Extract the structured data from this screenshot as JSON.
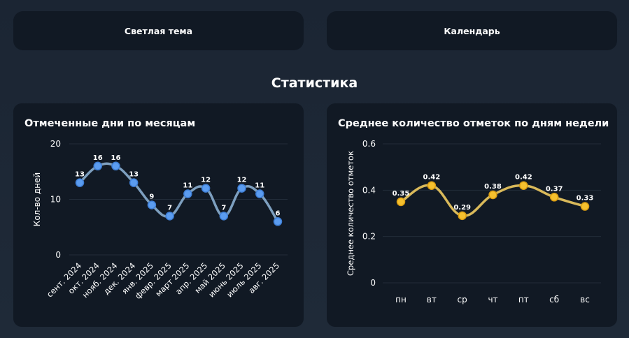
{
  "top_buttons": {
    "theme_label": "Светлая тема",
    "calendar_label": "Календарь"
  },
  "section_title": "Статистика",
  "charts": {
    "months_title": "Отмеченные дни по месяцам",
    "weekdays_title": "Среднее количество отметок по дням недели"
  },
  "colors": {
    "months_line": "#7d9fbf",
    "months_point": "#5b9cf0",
    "weekdays_line": "#d9b95a",
    "weekdays_point": "#f5c02e",
    "card_bg": "#111924"
  },
  "chart_data": [
    {
      "type": "line",
      "title": "Отмеченные дни по месяцам",
      "xlabel": "",
      "ylabel": "Кол-во дней",
      "categories": [
        "сент. 2024",
        "окт. 2024",
        "нояб. 2024",
        "дек. 2024",
        "янв. 2025",
        "февр. 2025",
        "март 2025",
        "апр. 2025",
        "май 2025",
        "июнь 2025",
        "июль 2025",
        "авг. 2025"
      ],
      "values": [
        13,
        16,
        16,
        13,
        9,
        7,
        11,
        12,
        7,
        12,
        11,
        6
      ],
      "ylim": [
        0,
        20
      ],
      "yticks": [
        0,
        10,
        20
      ],
      "data_labels": true,
      "grid": true,
      "smooth": true
    },
    {
      "type": "line",
      "title": "Среднее количество отметок по дням недели",
      "xlabel": "",
      "ylabel": "Среднее количество отметок",
      "categories": [
        "пн",
        "вт",
        "ср",
        "чт",
        "пт",
        "сб",
        "вс"
      ],
      "values": [
        0.35,
        0.42,
        0.29,
        0.38,
        0.42,
        0.37,
        0.33
      ],
      "ylim": [
        0,
        0.6
      ],
      "yticks": [
        0,
        0.2,
        0.4,
        0.6
      ],
      "data_labels": true,
      "grid": true,
      "smooth": true
    }
  ]
}
